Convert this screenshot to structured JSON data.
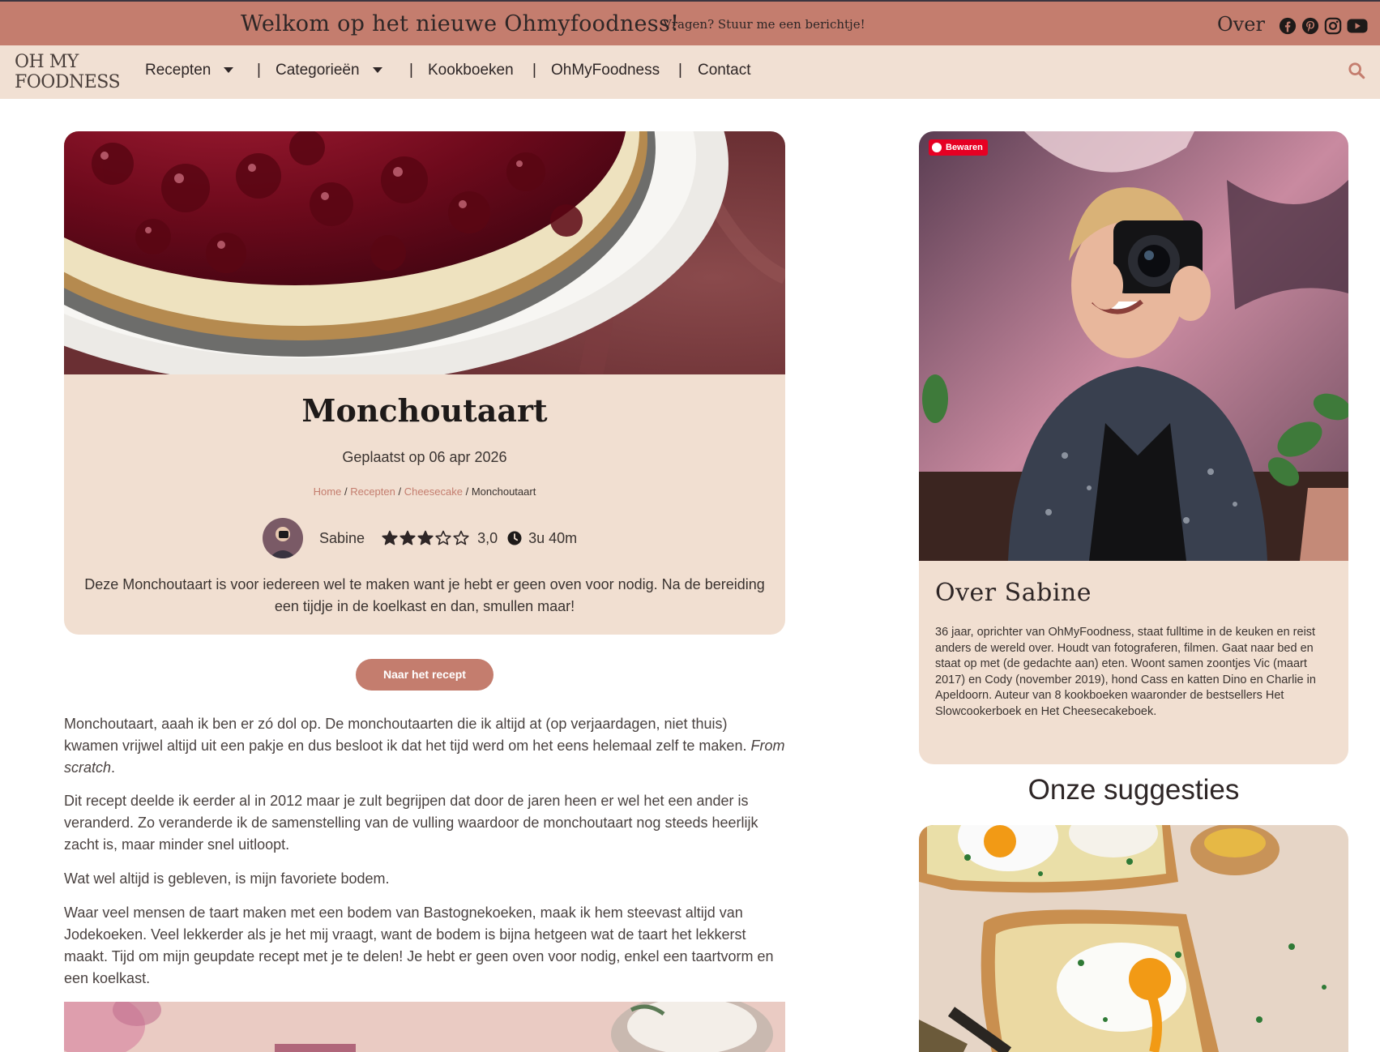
{
  "topbar": {
    "welcome": "Welkom op het nieuwe Ohmyfoodness!",
    "ask": "Vragen? Stuur me een berichtje!",
    "over": "Over",
    "social_icons": [
      "facebook-icon",
      "pinterest-icon",
      "instagram-icon",
      "youtube-icon"
    ]
  },
  "nav": {
    "logo_line1": "OH MY",
    "logo_line2": "FOODNESS",
    "items": [
      {
        "label": "Recepten"
      },
      {
        "label": "Categorieën"
      },
      {
        "label": "Kookboeken"
      },
      {
        "label": "OhMyFoodness"
      },
      {
        "label": "Contact"
      }
    ],
    "separator": "|"
  },
  "recipe": {
    "title": "Monchoutaart",
    "posted": "Geplaatst op 06 apr 2026",
    "breadcrumb": [
      {
        "label": "Home"
      },
      {
        "label": "Recepten"
      },
      {
        "label": "Cheesecake"
      },
      {
        "label": "Monchoutaart"
      }
    ],
    "breadcrumb_sep": " / ",
    "author": "Sabine",
    "rating": 3,
    "rating_max": 5,
    "rating_text": "3,0",
    "time": "3u 40m",
    "intro": "Deze Monchoutaart is voor iedereen wel te maken want je hebt er geen oven voor nodig. Na de bereiding een tijdje in de koelkast en dan, smullen maar!",
    "cta": "Naar het recept"
  },
  "article": {
    "p1": "Monchoutaart, aaah ik ben er zó dol op. De monchoutaarten die ik altijd at (op verjaardagen, niet thuis) kwamen vrijwel altijd uit een pakje en dus besloot ik dat het tijd werd om het eens helemaal zelf te maken. ",
    "p1_em": "From scratch",
    "p1_end": ".",
    "p2": "Dit recept deelde ik eerder al in 2012 maar je zult begrijpen dat door de jaren heen er wel het een ander is veranderd. Zo veranderde ik de samenstelling van de vulling waardoor de monchoutaart nog steeds heerlijk zacht is, maar minder snel uitloopt.",
    "p3": "Wat wel altijd is gebleven, is mijn favoriete bodem.",
    "p4": "Waar veel mensen de taart maken met een bodem van Bastognekoeken, maak ik hem steevast altijd van Jodekoeken. Veel lekkerder als je het mij vraagt, want de bodem is bijna hetgeen wat de taart het lekkerst maakt. Tijd om mijn geupdate recept met je te delen! Je hebt er geen oven voor nodig, enkel een taartvorm en een koelkast."
  },
  "sidebar": {
    "pin_label": "Bewaren",
    "about_title": "Over Sabine",
    "about_text": "36 jaar, oprichter van OhMyFoodness, staat fulltime in de keuken en reist anders de wereld over. Houdt van fotograferen, filmen. Gaat naar bed en staat op met (de gedachte aan) eten. Woont samen zoontjes Vic (maart 2017) en Cody (november 2019), hond Cass en katten Dino en Charlie in Apeldoorn. Auteur van 8 kookboeken waaronder de bestsellers Het Slowcookerboek en Het Cheesecakeboek.",
    "suggestions_title": "Onze suggesties"
  },
  "colors": {
    "accent": "#c47d6e",
    "cream": "#f1dfd1",
    "text": "#3a3330"
  }
}
